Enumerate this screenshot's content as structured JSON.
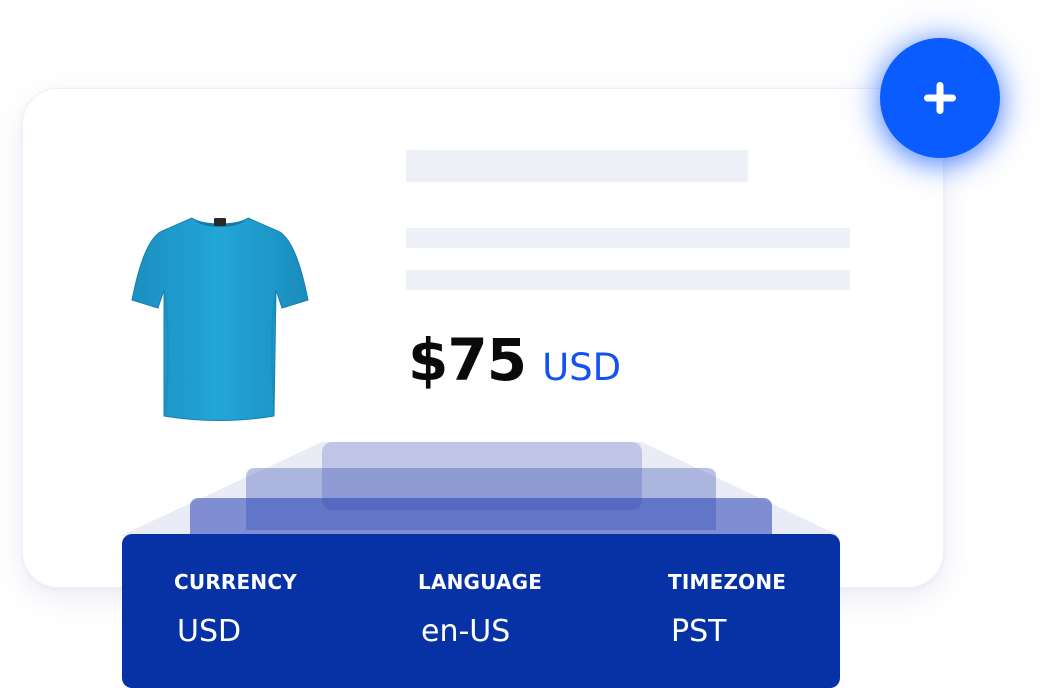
{
  "product": {
    "image_alt": "blue t-shirt",
    "price_amount": "$75",
    "price_currency": "USD"
  },
  "add_button": {
    "icon": "plus-icon"
  },
  "settings": [
    {
      "label": "CURRENCY",
      "value": "USD"
    },
    {
      "label": "LANGUAGE",
      "value": "en-US"
    },
    {
      "label": "TIMEZONE",
      "value": "PST"
    }
  ],
  "colors": {
    "accent": "#0a5cff",
    "currency_text": "#1452f0",
    "panel": "#0732a6",
    "shirt": "#1e9fd2",
    "skeleton": "#edf0f7"
  }
}
